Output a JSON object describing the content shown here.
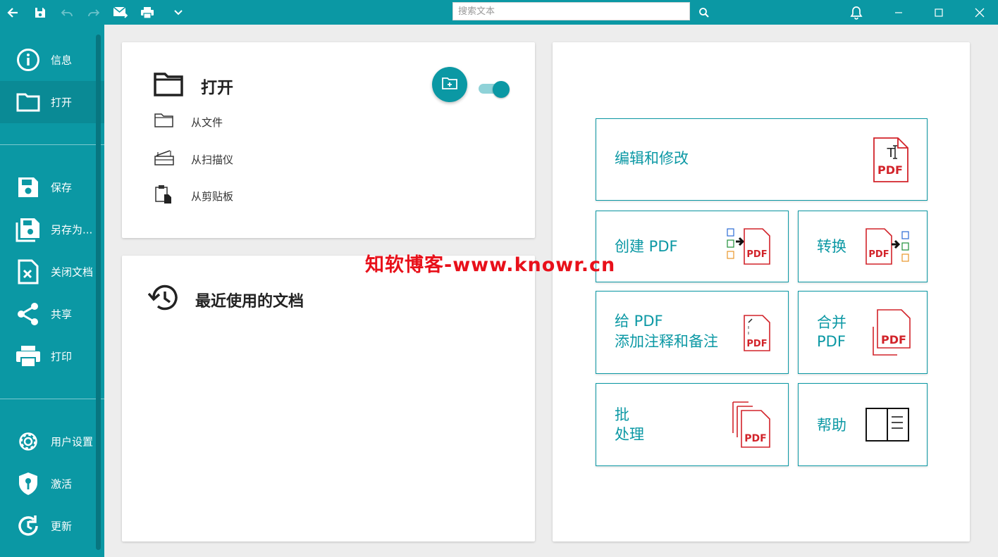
{
  "toolbar": {
    "search_placeholder": "搜索文本",
    "icons": [
      "back-icon",
      "save-icon",
      "undo-icon",
      "redo-icon",
      "mail-icon",
      "print-icon",
      "chevron-down-icon",
      "search-icon",
      "bell-icon",
      "minimize-icon",
      "maximize-icon",
      "close-icon"
    ]
  },
  "sidebar": {
    "items": [
      {
        "label": "信息",
        "icon": "info-icon"
      },
      {
        "label": "打开",
        "icon": "folder-icon"
      },
      {
        "label": "保存",
        "icon": "save-icon"
      },
      {
        "label": "另存为...",
        "icon": "save-as-icon"
      },
      {
        "label": "关闭文档",
        "icon": "close-document-icon"
      },
      {
        "label": "共享",
        "icon": "share-icon"
      },
      {
        "label": "打印",
        "icon": "print-icon"
      },
      {
        "label": "用户设置",
        "icon": "gear-icon"
      },
      {
        "label": "激活",
        "icon": "shield-key-icon"
      },
      {
        "label": "更新",
        "icon": "update-icon"
      }
    ]
  },
  "open_panel": {
    "title": "打开",
    "rows": [
      {
        "label": "从文件",
        "icon": "folder-outline-icon"
      },
      {
        "label": "从扫描仪",
        "icon": "scanner-icon"
      },
      {
        "label": "从剪贴板",
        "icon": "clipboard-icon"
      }
    ],
    "toggle_on": true
  },
  "recent_panel": {
    "title": "最近使用的文档"
  },
  "tiles": {
    "edit": {
      "label": "编辑和修改",
      "icon_text": "PDF",
      "icon_t": "T"
    },
    "create": {
      "label": "创建 PDF",
      "icon_text": "PDF"
    },
    "convert": {
      "label": "转换",
      "icon_text": "PDF"
    },
    "annotate": {
      "line1": "给 PDF",
      "line2": "添加注释和备注",
      "icon_text": "PDF"
    },
    "merge": {
      "line1": "合并",
      "line2": "PDF",
      "icon_text": "PDF"
    },
    "batch": {
      "line1": "批",
      "line2": "处理",
      "icon_text": "PDF"
    },
    "help": {
      "label": "帮助"
    }
  },
  "watermark": "知软博客-www.knowr.cn",
  "colors": {
    "accent": "#0b98a4",
    "pdf_red": "#d2232a"
  }
}
